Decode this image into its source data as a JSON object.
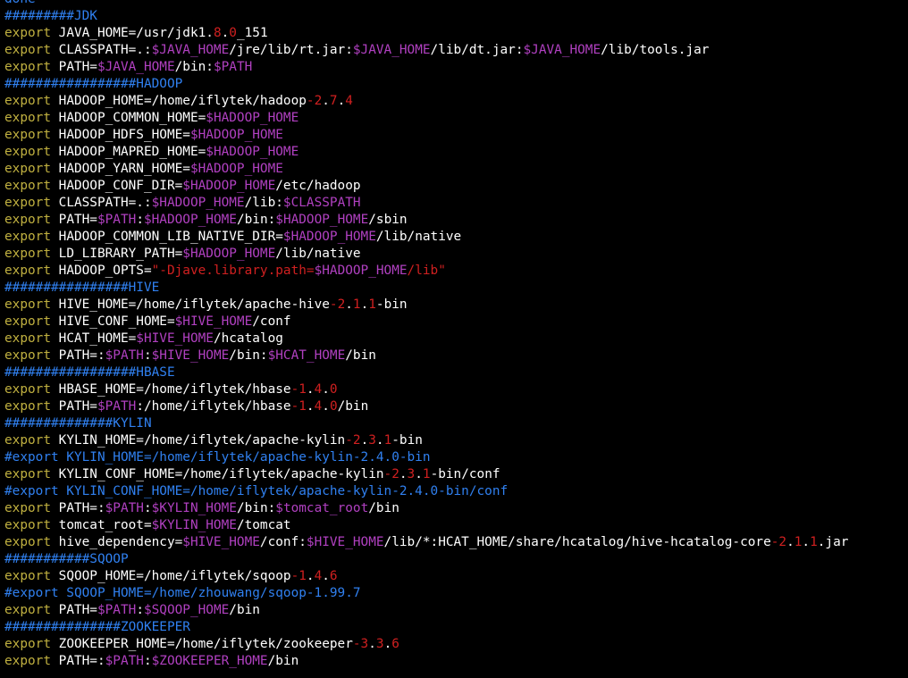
{
  "colors": {
    "background": "#000000",
    "plain": "#ffffff",
    "keyword": "#c0b040",
    "variable": "#b040c0",
    "number": "#d02020",
    "comment": "#3080f0"
  },
  "lines": [
    [
      [
        "cmt",
        "done"
      ]
    ],
    [
      [
        "cmt",
        "#########JDK"
      ]
    ],
    [
      [
        "kw",
        "export "
      ],
      [
        "plain",
        "JAVA_HOME=/usr/jdk1."
      ],
      [
        "num",
        "8"
      ],
      [
        "plain",
        "."
      ],
      [
        "num",
        "0"
      ],
      [
        "plain",
        "_151"
      ]
    ],
    [
      [
        "kw",
        "export "
      ],
      [
        "plain",
        "CLASSPATH=.:"
      ],
      [
        "var",
        "$JAVA_HOME"
      ],
      [
        "plain",
        "/jre/lib/rt.jar:"
      ],
      [
        "var",
        "$JAVA_HOME"
      ],
      [
        "plain",
        "/lib/dt.jar:"
      ],
      [
        "var",
        "$JAVA_HOME"
      ],
      [
        "plain",
        "/lib/tools.jar"
      ]
    ],
    [
      [
        "kw",
        "export "
      ],
      [
        "plain",
        "PATH="
      ],
      [
        "var",
        "$JAVA_HOME"
      ],
      [
        "plain",
        "/bin:"
      ],
      [
        "var",
        "$PATH"
      ]
    ],
    [
      [
        "cmt",
        "#################HADOOP"
      ]
    ],
    [
      [
        "kw",
        "export "
      ],
      [
        "plain",
        "HADOOP_HOME=/home/iflytek/hadoop"
      ],
      [
        "num",
        "-2"
      ],
      [
        "plain",
        "."
      ],
      [
        "num",
        "7"
      ],
      [
        "plain",
        "."
      ],
      [
        "num",
        "4"
      ]
    ],
    [
      [
        "kw",
        "export "
      ],
      [
        "plain",
        "HADOOP_COMMON_HOME="
      ],
      [
        "var",
        "$HADOOP_HOME"
      ]
    ],
    [
      [
        "kw",
        "export "
      ],
      [
        "plain",
        "HADOOP_HDFS_HOME="
      ],
      [
        "var",
        "$HADOOP_HOME"
      ]
    ],
    [
      [
        "kw",
        "export "
      ],
      [
        "plain",
        "HADOOP_MAPRED_HOME="
      ],
      [
        "var",
        "$HADOOP_HOME"
      ]
    ],
    [
      [
        "kw",
        "export "
      ],
      [
        "plain",
        "HADOOP_YARN_HOME="
      ],
      [
        "var",
        "$HADOOP_HOME"
      ]
    ],
    [
      [
        "kw",
        "export "
      ],
      [
        "plain",
        "HADOOP_CONF_DIR="
      ],
      [
        "var",
        "$HADOOP_HOME"
      ],
      [
        "plain",
        "/etc/hadoop"
      ]
    ],
    [
      [
        "kw",
        "export "
      ],
      [
        "plain",
        "CLASSPATH=.:"
      ],
      [
        "var",
        "$HADOOP_HOME"
      ],
      [
        "plain",
        "/lib:"
      ],
      [
        "var",
        "$CLASSPATH"
      ]
    ],
    [
      [
        "kw",
        "export "
      ],
      [
        "plain",
        "PATH="
      ],
      [
        "var",
        "$PATH"
      ],
      [
        "plain",
        ":"
      ],
      [
        "var",
        "$HADOOP_HOME"
      ],
      [
        "plain",
        "/bin:"
      ],
      [
        "var",
        "$HADOOP_HOME"
      ],
      [
        "plain",
        "/sbin"
      ]
    ],
    [
      [
        "kw",
        "export "
      ],
      [
        "plain",
        "HADOOP_COMMON_LIB_NATIVE_DIR="
      ],
      [
        "var",
        "$HADOOP_HOME"
      ],
      [
        "plain",
        "/lib/native"
      ]
    ],
    [
      [
        "kw",
        "export "
      ],
      [
        "plain",
        "LD_LIBRARY_PATH="
      ],
      [
        "var",
        "$HADOOP_HOME"
      ],
      [
        "plain",
        "/lib/native"
      ]
    ],
    [
      [
        "kw",
        "export "
      ],
      [
        "plain",
        "HADOOP_OPTS="
      ],
      [
        "num",
        "\"-Djave.library.path="
      ],
      [
        "var",
        "$HADOOP_HOME"
      ],
      [
        "num",
        "/lib\""
      ]
    ],
    [
      [
        "cmt",
        "################HIVE"
      ]
    ],
    [
      [
        "kw",
        "export "
      ],
      [
        "plain",
        "HIVE_HOME=/home/iflytek/apache-hive"
      ],
      [
        "num",
        "-2"
      ],
      [
        "plain",
        "."
      ],
      [
        "num",
        "1"
      ],
      [
        "plain",
        "."
      ],
      [
        "num",
        "1"
      ],
      [
        "plain",
        "-bin"
      ]
    ],
    [
      [
        "kw",
        "export "
      ],
      [
        "plain",
        "HIVE_CONF_HOME="
      ],
      [
        "var",
        "$HIVE_HOME"
      ],
      [
        "plain",
        "/conf"
      ]
    ],
    [
      [
        "kw",
        "export "
      ],
      [
        "plain",
        "HCAT_HOME="
      ],
      [
        "var",
        "$HIVE_HOME"
      ],
      [
        "plain",
        "/hcatalog"
      ]
    ],
    [
      [
        "kw",
        "export "
      ],
      [
        "plain",
        "PATH=:"
      ],
      [
        "var",
        "$PATH"
      ],
      [
        "plain",
        ":"
      ],
      [
        "var",
        "$HIVE_HOME"
      ],
      [
        "plain",
        "/bin:"
      ],
      [
        "var",
        "$HCAT_HOME"
      ],
      [
        "plain",
        "/bin"
      ]
    ],
    [
      [
        "cmt",
        "#################HBASE"
      ]
    ],
    [
      [
        "kw",
        "export "
      ],
      [
        "plain",
        "HBASE_HOME=/home/iflytek/hbase"
      ],
      [
        "num",
        "-1"
      ],
      [
        "plain",
        "."
      ],
      [
        "num",
        "4"
      ],
      [
        "plain",
        "."
      ],
      [
        "num",
        "0"
      ]
    ],
    [
      [
        "kw",
        "export "
      ],
      [
        "plain",
        "PATH="
      ],
      [
        "var",
        "$PATH"
      ],
      [
        "plain",
        ":/home/iflytek/hbase"
      ],
      [
        "num",
        "-1"
      ],
      [
        "plain",
        "."
      ],
      [
        "num",
        "4"
      ],
      [
        "plain",
        "."
      ],
      [
        "num",
        "0"
      ],
      [
        "plain",
        "/bin"
      ]
    ],
    [
      [
        "cmt",
        "##############KYLIN"
      ]
    ],
    [
      [
        "kw",
        "export "
      ],
      [
        "plain",
        "KYLIN_HOME=/home/iflytek/apache-kylin"
      ],
      [
        "num",
        "-2"
      ],
      [
        "plain",
        "."
      ],
      [
        "num",
        "3"
      ],
      [
        "plain",
        "."
      ],
      [
        "num",
        "1"
      ],
      [
        "plain",
        "-bin"
      ]
    ],
    [
      [
        "cmt",
        "#export KYLIN_HOME=/home/iflytek/apache-kylin-2.4.0-bin"
      ]
    ],
    [
      [
        "kw",
        "export "
      ],
      [
        "plain",
        "KYLIN_CONF_HOME=/home/iflytek/apache-kylin"
      ],
      [
        "num",
        "-2"
      ],
      [
        "plain",
        "."
      ],
      [
        "num",
        "3"
      ],
      [
        "plain",
        "."
      ],
      [
        "num",
        "1"
      ],
      [
        "plain",
        "-bin/conf"
      ]
    ],
    [
      [
        "cmt",
        "#export KYLIN_CONF_HOME=/home/iflytek/apache-kylin-2.4.0-bin/conf"
      ]
    ],
    [
      [
        "kw",
        "export "
      ],
      [
        "plain",
        "PATH=:"
      ],
      [
        "var",
        "$PATH"
      ],
      [
        "plain",
        ":"
      ],
      [
        "var",
        "$KYLIN_HOME"
      ],
      [
        "plain",
        "/bin:"
      ],
      [
        "var",
        "$tomcat_root"
      ],
      [
        "plain",
        "/bin"
      ]
    ],
    [
      [
        "kw",
        "export "
      ],
      [
        "plain",
        "tomcat_root="
      ],
      [
        "var",
        "$KYLIN_HOME"
      ],
      [
        "plain",
        "/tomcat"
      ]
    ],
    [
      [
        "kw",
        "export "
      ],
      [
        "plain",
        "hive_dependency="
      ],
      [
        "var",
        "$HIVE_HOME"
      ],
      [
        "plain",
        "/conf:"
      ],
      [
        "var",
        "$HIVE_HOME"
      ],
      [
        "plain",
        "/lib/*:HCAT_HOME/share/hcatalog/hive-hcatalog-core"
      ],
      [
        "num",
        "-2"
      ],
      [
        "plain",
        "."
      ],
      [
        "num",
        "1"
      ],
      [
        "plain",
        "."
      ],
      [
        "num",
        "1"
      ],
      [
        "plain",
        ".jar"
      ]
    ],
    [
      [
        "cmt",
        "###########SQOOP"
      ]
    ],
    [
      [
        "kw",
        "export "
      ],
      [
        "plain",
        "SQOOP_HOME=/home/iflytek/sqoop"
      ],
      [
        "num",
        "-1"
      ],
      [
        "plain",
        "."
      ],
      [
        "num",
        "4"
      ],
      [
        "plain",
        "."
      ],
      [
        "num",
        "6"
      ]
    ],
    [
      [
        "cmt",
        "#export SQOOP_HOME=/home/zhouwang/sqoop-1.99.7"
      ]
    ],
    [
      [
        "kw",
        "export "
      ],
      [
        "plain",
        "PATH="
      ],
      [
        "var",
        "$PATH"
      ],
      [
        "plain",
        ":"
      ],
      [
        "var",
        "$SQOOP_HOME"
      ],
      [
        "plain",
        "/bin"
      ]
    ],
    [
      [
        "cmt",
        "###############ZOOKEEPER"
      ]
    ],
    [
      [
        "kw",
        "export "
      ],
      [
        "plain",
        "ZOOKEEPER_HOME=/home/iflytek/zookeeper"
      ],
      [
        "num",
        "-3"
      ],
      [
        "plain",
        "."
      ],
      [
        "num",
        "3"
      ],
      [
        "plain",
        "."
      ],
      [
        "num",
        "6"
      ]
    ],
    [
      [
        "kw",
        "export "
      ],
      [
        "plain",
        "PATH=:"
      ],
      [
        "var",
        "$PATH"
      ],
      [
        "plain",
        ":"
      ],
      [
        "var",
        "$ZOOKEEPER_HOME"
      ],
      [
        "plain",
        "/bin"
      ]
    ]
  ]
}
